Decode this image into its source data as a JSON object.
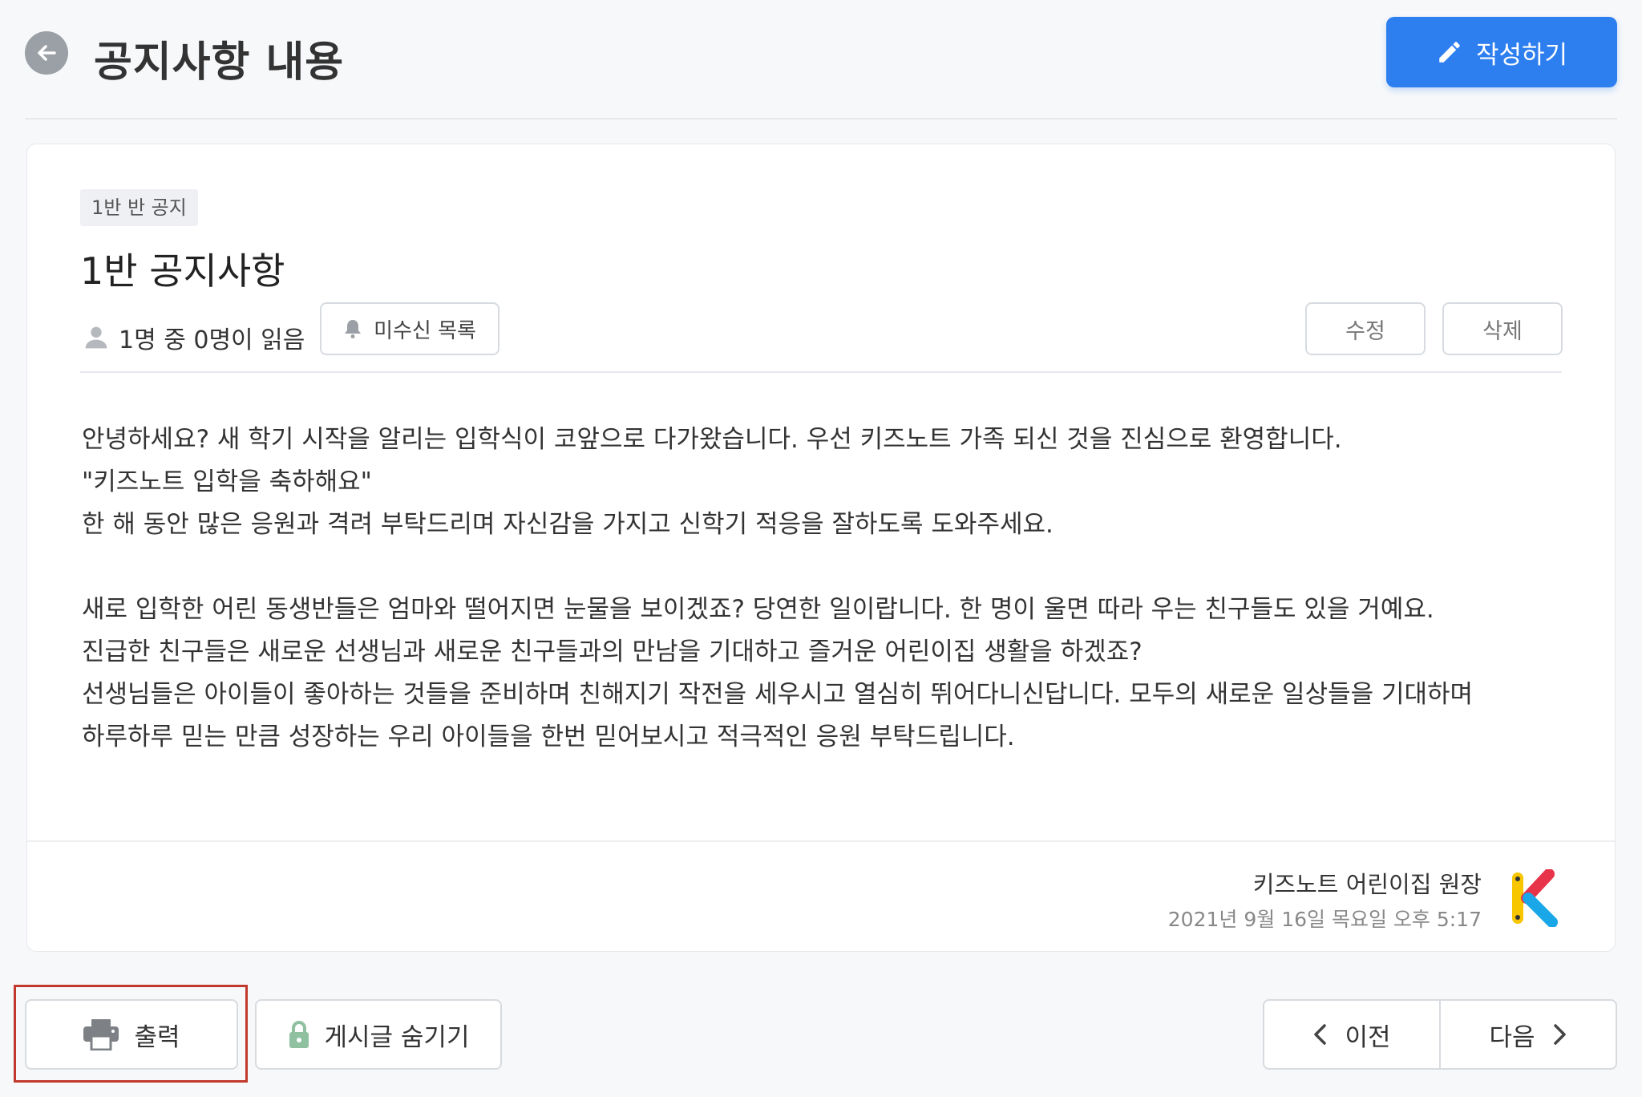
{
  "header": {
    "title": "공지사항 내용",
    "write_label": "작성하기"
  },
  "post": {
    "category": "1반 반 공지",
    "title": "1반 공지사항",
    "read_status": "1명 중 0명이 읽음",
    "unread_list_label": "미수신 목록",
    "edit_label": "수정",
    "delete_label": "삭제",
    "body": [
      "안녕하세요? 새 학기 시작을 알리는 입학식이 코앞으로 다가왔습니다. 우선 키즈노트 가족 되신 것을 진심으로 환영합니다.",
      "\"키즈노트 입학을 축하해요\"",
      "한 해 동안 많은 응원과 격려 부탁드리며 자신감을 가지고 신학기 적응을 잘하도록 도와주세요.",
      "",
      "새로 입학한 어린 동생반들은 엄마와 떨어지면 눈물을 보이겠죠? 당연한 일이랍니다. 한 명이 울면 따라 우는 친구들도 있을 거예요.",
      "진급한 친구들은 새로운 선생님과 새로운 친구들과의 만남을 기대하고 즐거운 어린이집 생활을 하겠죠?",
      "선생님들은 아이들이 좋아하는 것들을 준비하며 친해지기 작전을 세우시고 열심히 뛰어다니신답니다. 모두의 새로운 일상들을 기대하며",
      "하루하루 믿는 만큼 성장하는 우리 아이들을 한번 믿어보시고 적극적인 응원 부탁드립니다."
    ],
    "author": "키즈노트 어린이집 원장",
    "date": "2021년 9월 16일 목요일 오후 5:17"
  },
  "actions": {
    "print_label": "출력",
    "hide_label": "게시글 숨기기",
    "prev_label": "이전",
    "next_label": "다음"
  },
  "icons": {
    "back": "arrow-left-icon",
    "write": "pencil-icon",
    "user": "user-icon",
    "bell": "bell-icon",
    "print": "printer-icon",
    "lock": "lock-icon",
    "prev": "chevron-left-icon",
    "next": "chevron-right-icon",
    "logo": "kidsnote-logo"
  },
  "colors": {
    "primary": "#2d7ff0",
    "highlight_border": "#c0392b",
    "lock_icon": "#8fc1a0"
  }
}
